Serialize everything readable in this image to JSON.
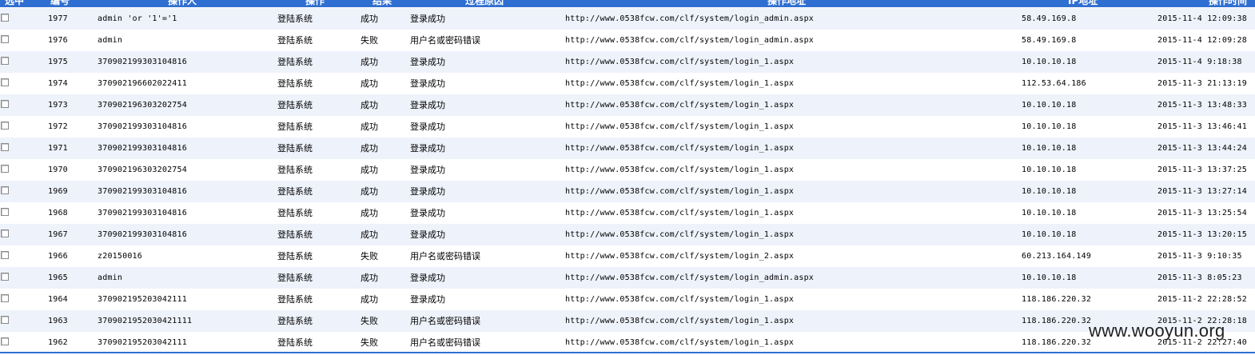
{
  "header": {
    "cols": [
      "选中",
      "编号",
      "操作人",
      "操作",
      "结果",
      "过程原因",
      "操作地址",
      "IP地址",
      "操作时间"
    ]
  },
  "rows": [
    {
      "id": "1977",
      "user": "admin 'or '1'='1",
      "op": "登陆系统",
      "result": "成功",
      "reason": "登录成功",
      "url": "http://www.0538fcw.com/clf/system/login_admin.aspx",
      "ip": "58.49.169.8",
      "time": "2015-11-4 12:09:38"
    },
    {
      "id": "1976",
      "user": "admin",
      "op": "登陆系统",
      "result": "失败",
      "reason": "用户名或密码错误",
      "url": "http://www.0538fcw.com/clf/system/login_admin.aspx",
      "ip": "58.49.169.8",
      "time": "2015-11-4 12:09:28"
    },
    {
      "id": "1975",
      "user": "370902199303104816",
      "op": "登陆系统",
      "result": "成功",
      "reason": "登录成功",
      "url": "http://www.0538fcw.com/clf/system/login_1.aspx",
      "ip": "10.10.10.18",
      "time": "2015-11-4 9:18:38"
    },
    {
      "id": "1974",
      "user": "370902196602022411",
      "op": "登陆系统",
      "result": "成功",
      "reason": "登录成功",
      "url": "http://www.0538fcw.com/clf/system/login_1.aspx",
      "ip": "112.53.64.186",
      "time": "2015-11-3 21:13:19"
    },
    {
      "id": "1973",
      "user": "370902196303202754",
      "op": "登陆系统",
      "result": "成功",
      "reason": "登录成功",
      "url": "http://www.0538fcw.com/clf/system/login_1.aspx",
      "ip": "10.10.10.18",
      "time": "2015-11-3 13:48:33"
    },
    {
      "id": "1972",
      "user": "370902199303104816",
      "op": "登陆系统",
      "result": "成功",
      "reason": "登录成功",
      "url": "http://www.0538fcw.com/clf/system/login_1.aspx",
      "ip": "10.10.10.18",
      "time": "2015-11-3 13:46:41"
    },
    {
      "id": "1971",
      "user": "370902199303104816",
      "op": "登陆系统",
      "result": "成功",
      "reason": "登录成功",
      "url": "http://www.0538fcw.com/clf/system/login_1.aspx",
      "ip": "10.10.10.18",
      "time": "2015-11-3 13:44:24"
    },
    {
      "id": "1970",
      "user": "370902196303202754",
      "op": "登陆系统",
      "result": "成功",
      "reason": "登录成功",
      "url": "http://www.0538fcw.com/clf/system/login_1.aspx",
      "ip": "10.10.10.18",
      "time": "2015-11-3 13:37:25"
    },
    {
      "id": "1969",
      "user": "370902199303104816",
      "op": "登陆系统",
      "result": "成功",
      "reason": "登录成功",
      "url": "http://www.0538fcw.com/clf/system/login_1.aspx",
      "ip": "10.10.10.18",
      "time": "2015-11-3 13:27:14"
    },
    {
      "id": "1968",
      "user": "370902199303104816",
      "op": "登陆系统",
      "result": "成功",
      "reason": "登录成功",
      "url": "http://www.0538fcw.com/clf/system/login_1.aspx",
      "ip": "10.10.10.18",
      "time": "2015-11-3 13:25:54"
    },
    {
      "id": "1967",
      "user": "370902199303104816",
      "op": "登陆系统",
      "result": "成功",
      "reason": "登录成功",
      "url": "http://www.0538fcw.com/clf/system/login_1.aspx",
      "ip": "10.10.10.18",
      "time": "2015-11-3 13:20:15"
    },
    {
      "id": "1966",
      "user": "z20150016",
      "op": "登陆系统",
      "result": "失败",
      "reason": "用户名或密码错误",
      "url": "http://www.0538fcw.com/clf/system/login_2.aspx",
      "ip": "60.213.164.149",
      "time": "2015-11-3 9:10:35"
    },
    {
      "id": "1965",
      "user": "admin",
      "op": "登陆系统",
      "result": "成功",
      "reason": "登录成功",
      "url": "http://www.0538fcw.com/clf/system/login_admin.aspx",
      "ip": "10.10.10.18",
      "time": "2015-11-3 8:05:23"
    },
    {
      "id": "1964",
      "user": "370902195203042111",
      "op": "登陆系统",
      "result": "成功",
      "reason": "登录成功",
      "url": "http://www.0538fcw.com/clf/system/login_1.aspx",
      "ip": "118.186.220.32",
      "time": "2015-11-2 22:28:52"
    },
    {
      "id": "1963",
      "user": "3709021952030421111",
      "op": "登陆系统",
      "result": "失败",
      "reason": "用户名或密码错误",
      "url": "http://www.0538fcw.com/clf/system/login_1.aspx",
      "ip": "118.186.220.32",
      "time": "2015-11-2 22:28:18"
    },
    {
      "id": "1962",
      "user": "370902195203042111",
      "op": "登陆系统",
      "result": "失败",
      "reason": "用户名或密码错误",
      "url": "http://www.0538fcw.com/clf/system/login_1.aspx",
      "ip": "118.186.220.32",
      "time": "2015-11-2 22:27:40"
    }
  ],
  "watermark": "www.wooyun.org"
}
